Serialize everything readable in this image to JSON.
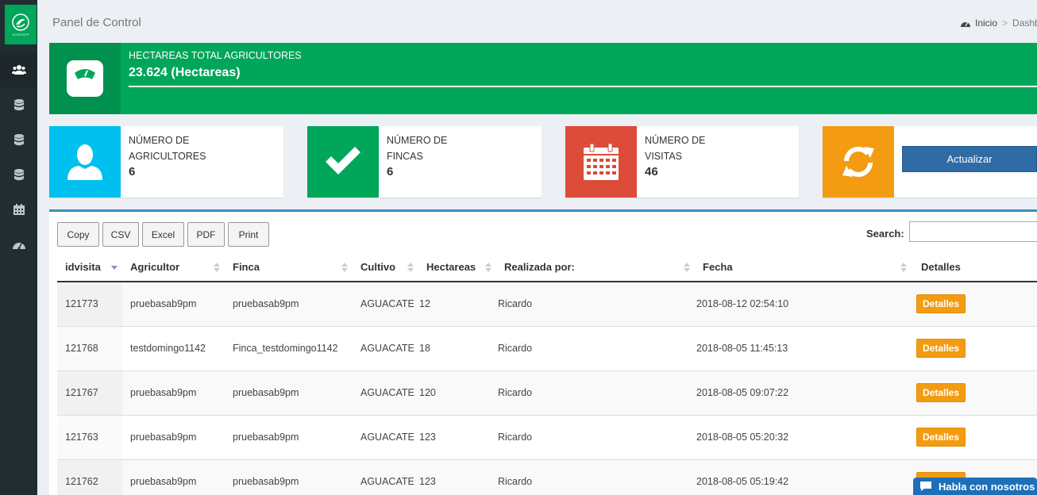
{
  "header": {
    "title": "Panel de Control"
  },
  "breadcrumb": {
    "home": "Inicio",
    "separator": ">",
    "current": "Dashb"
  },
  "sidebar": {
    "items": [
      {
        "icon": "users-icon",
        "active": true
      },
      {
        "icon": "database-icon"
      },
      {
        "icon": "database-icon"
      },
      {
        "icon": "database-icon"
      },
      {
        "icon": "calendar-icon"
      },
      {
        "icon": "dashboard-icon"
      }
    ]
  },
  "banner": {
    "label": "HECTAREAS TOTAL AGRICULTORES",
    "value": "23.624 (Hectareas)",
    "icon": "scale-icon",
    "color": "#00a65a"
  },
  "stats": [
    {
      "label": "NÚMERO DE AGRICULTORES",
      "value": "6",
      "icon": "user-icon",
      "color": "#00c0ef"
    },
    {
      "label": "NÚMERO DE FINCAS",
      "value": "6",
      "icon": "check-icon",
      "color": "#00a65a"
    },
    {
      "label": "NÚMERO DE VISITAS",
      "value": "46",
      "icon": "calendar-icon",
      "color": "#dd4b39"
    }
  ],
  "refresh": {
    "button_label": "Actualizar",
    "icon": "refresh-icon",
    "color": "#f39c12"
  },
  "table": {
    "export_buttons": [
      "Copy",
      "CSV",
      "Excel",
      "PDF",
      "Print"
    ],
    "search_label": "Search:",
    "columns": [
      "idvisita",
      "Agricultor",
      "Finca",
      "Cultivo",
      "Hectareas",
      "Realizada por:",
      "Fecha",
      "Detalles"
    ],
    "rows": [
      {
        "idvisita": "121773",
        "agricultor": "pruebasab9pm",
        "finca": "pruebasab9pm",
        "cultivo": "AGUACATE",
        "hectareas": "12",
        "realizada_por": "Ricardo",
        "fecha": "2018-08-12 02:54:10",
        "detalles": "Detalles"
      },
      {
        "idvisita": "121768",
        "agricultor": "testdomingo1142",
        "finca": "Finca_testdomingo1142",
        "cultivo": "AGUACATE",
        "hectareas": "18",
        "realizada_por": "Ricardo",
        "fecha": "2018-08-05 11:45:13",
        "detalles": "Detalles"
      },
      {
        "idvisita": "121767",
        "agricultor": "pruebasab9pm",
        "finca": "pruebasab9pm",
        "cultivo": "AGUACATE",
        "hectareas": "120",
        "realizada_por": "Ricardo",
        "fecha": "2018-08-05 09:07:22",
        "detalles": "Detalles"
      },
      {
        "idvisita": "121763",
        "agricultor": "pruebasab9pm",
        "finca": "pruebasab9pm",
        "cultivo": "AGUACATE",
        "hectareas": "123",
        "realizada_por": "Ricardo",
        "fecha": "2018-08-05 05:20:32",
        "detalles": "Detalles"
      },
      {
        "idvisita": "121762",
        "agricultor": "pruebasab9pm",
        "finca": "pruebasab9pm",
        "cultivo": "AGUACATE",
        "hectareas": "123",
        "realizada_por": "Ricardo",
        "fecha": "2018-08-05 05:19:42",
        "detalles": "Detalles"
      }
    ]
  },
  "chat": {
    "label": "Habla con nosotros"
  }
}
